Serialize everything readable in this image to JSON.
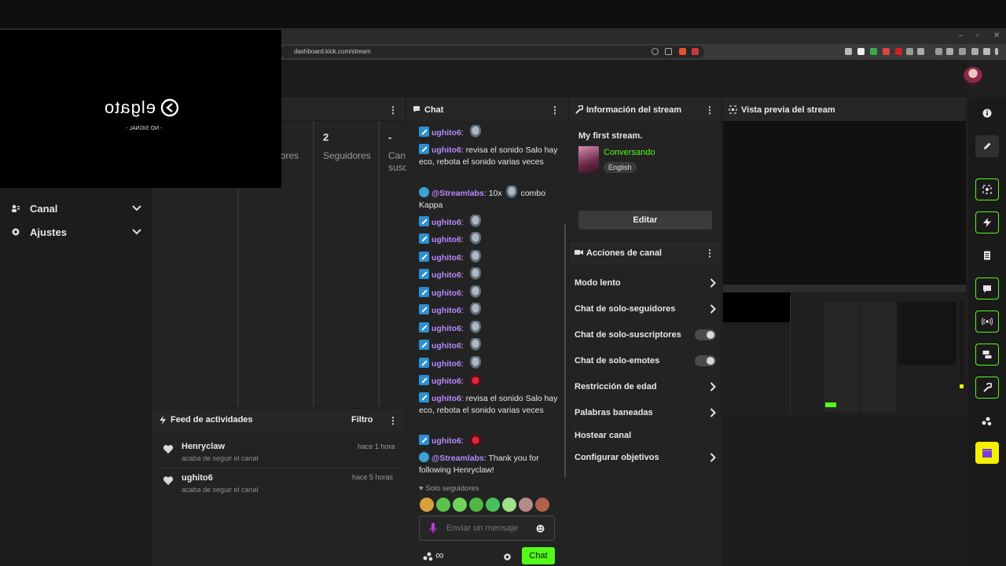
{
  "browser": {
    "url": "dashboard.kick.com/stream"
  },
  "overlay": {
    "logo": "elgato",
    "subtitle": "- NO SIGNAL -"
  },
  "sidebar": {
    "items": [
      {
        "label": "Canal",
        "icon": "users-icon"
      },
      {
        "label": "Ajustes",
        "icon": "gear-icon"
      }
    ]
  },
  "stats": {
    "cells": [
      {
        "value": "",
        "label": "dores"
      },
      {
        "value": "2",
        "label": "Seguidores"
      },
      {
        "value": "-",
        "label": "Can",
        "label2": "susc"
      }
    ]
  },
  "feed": {
    "title": "Feed de actividades",
    "filter_label": "Filtro",
    "items": [
      {
        "name": "Henryclaw",
        "sub": "acaba de seguir el canal",
        "time": "hace 1 hora"
      },
      {
        "name": "ughito6",
        "sub": "acaba de seguir el canal",
        "time": "hace 5 horas"
      }
    ]
  },
  "chat": {
    "title": "Chat",
    "messages": [
      {
        "user": "ughito6",
        "text": "",
        "emote": "rat"
      },
      {
        "user": "ughito6",
        "text": "revisa el sonido Salo hay eco, rebota el sonido varias veces"
      },
      {
        "user": "@Streamlabs",
        "bot": true,
        "text": "10x",
        "emote": "rat",
        "text2": "combo Kappa"
      },
      {
        "user": "ughito6",
        "emote": "rat"
      },
      {
        "user": "ughito6",
        "emote": "rat"
      },
      {
        "user": "ughito6",
        "emote": "rat"
      },
      {
        "user": "ughito6",
        "emote": "rat"
      },
      {
        "user": "ughito6",
        "emote": "rat"
      },
      {
        "user": "ughito6",
        "emote": "rat"
      },
      {
        "user": "ughito6",
        "emote": "rat"
      },
      {
        "user": "ughito6",
        "emote": "rat"
      },
      {
        "user": "ughito6",
        "emote": "rat"
      },
      {
        "user": "ughito6",
        "emote": "red"
      },
      {
        "user": "ughito6",
        "text": "revisa el sonido Salo hay eco, rebota el sonido varias veces"
      },
      {
        "user": "ughito6",
        "emote": "red"
      },
      {
        "user": "@Streamlabs",
        "bot": true,
        "text": "Thank you for following Henryclaw!"
      }
    ],
    "followers_only": "Solo seguidores",
    "input_placeholder": "Enviar un mensaje",
    "send_label": "Chat",
    "emote_colors": [
      "#d9a03a",
      "#58c24a",
      "#6dd35a",
      "#4fb843",
      "#47c15a",
      "#9fe28a",
      "#b48b8b",
      "#b3604a"
    ]
  },
  "stream_info": {
    "title_label": "Información del stream",
    "stream_title": "My first stream.",
    "category": "Conversando",
    "language": "English",
    "edit_label": "Editar"
  },
  "actions": {
    "title": "Acciones de canal",
    "items": [
      {
        "label": "Modo lento",
        "control": "chevron"
      },
      {
        "label": "Chat de solo-seguidores",
        "control": "chevron"
      },
      {
        "label": "Chat de solo-suscriptores",
        "control": "toggle"
      },
      {
        "label": "Chat de solo-emotes",
        "control": "toggle"
      },
      {
        "label": "Restricción de edad",
        "control": "chevron"
      },
      {
        "label": "Palabras baneadas",
        "control": "chevron"
      },
      {
        "label": "Hostear canal",
        "control": "none"
      },
      {
        "label": "Configurar objetivos",
        "control": "chevron"
      }
    ]
  },
  "preview": {
    "title": "Vista previa del stream"
  },
  "colors": {
    "accent": "#53fc18",
    "username": "#b58aff",
    "badge": "#2d8fd4"
  }
}
